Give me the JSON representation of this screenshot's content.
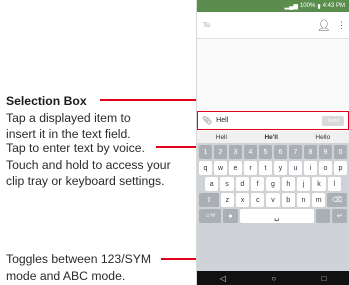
{
  "callouts": {
    "selection_box": {
      "title": "Selection Box",
      "lines": [
        "Tap a displayed item to",
        "insert it in the text field."
      ]
    },
    "voice": {
      "lines": [
        "Tap to enter text by voice.",
        "Touch and hold to access your",
        "clip tray or keyboard settings."
      ]
    },
    "toggle": {
      "lines": [
        "Toggles between 123/SYM",
        "mode and ABC mode."
      ]
    }
  },
  "phone": {
    "status": {
      "signal": "▂▄▆",
      "battery": "100%",
      "time": "4:43 PM"
    },
    "app": {
      "to_placeholder": "To",
      "contact_icon": "person-icon",
      "menu_icon": "more-vert-icon"
    },
    "compose": {
      "attach_icon": "paperclip-icon",
      "text": "Hell",
      "send_label": "Send"
    },
    "suggestions": [
      "Hell",
      "He'll",
      "Hello"
    ],
    "keyboard": {
      "numbers": [
        "1",
        "2",
        "3",
        "4",
        "5",
        "6",
        "7",
        "8",
        "9",
        "0"
      ],
      "row1": [
        "q",
        "w",
        "e",
        "r",
        "t",
        "y",
        "u",
        "i",
        "o",
        "p"
      ],
      "row2": [
        "a",
        "s",
        "d",
        "f",
        "g",
        "h",
        "j",
        "k",
        "l"
      ],
      "row3": [
        "⇧",
        "z",
        "x",
        "c",
        "v",
        "b",
        "n",
        "m",
        "⌫"
      ],
      "row4": {
        "sym": "☺!#",
        "mic": "●",
        "space": "␣",
        "enter": "↵"
      }
    },
    "nav": {
      "back": "◁",
      "home": "○",
      "recent": "□"
    }
  },
  "colors": {
    "accent": "#e3001b",
    "statusbar": "#5b8e4e",
    "keyboard": "#cfd3d7"
  }
}
